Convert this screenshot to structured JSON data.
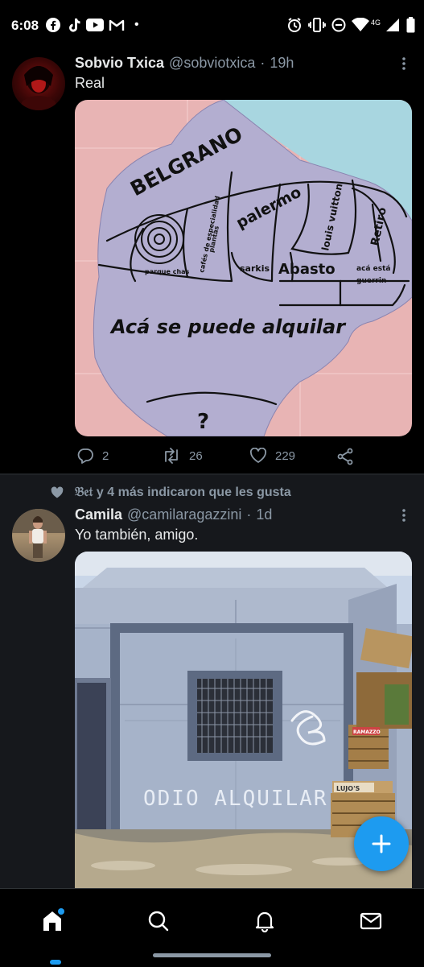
{
  "status_bar": {
    "time": "6:08",
    "network_label": "4G",
    "dot": "•"
  },
  "tweet1": {
    "display_name": "Sobvio Txica",
    "handle": "@sobviotxica",
    "separator": "·",
    "time": "19h",
    "text": "Real",
    "map": {
      "labels": {
        "belgrano": "BELGRANO",
        "palermo": "palermo",
        "louis_vuitton": "louis vuitton",
        "retiro": "Retiro",
        "cafes_line1": "cafés de especialidad",
        "cafes_line2": "plantas",
        "parque_chas": "parque chas",
        "sarkis": "sarkis",
        "abasto": "Abasto",
        "aca_esta_line1": "acá está",
        "aca_esta_line2": "guerrin",
        "main": "Acá se puede alquilar",
        "question": "?"
      }
    },
    "actions": {
      "replies": "2",
      "retweets": "26",
      "likes": "229"
    }
  },
  "tweet2": {
    "social_context": "𝔅𝔢𝔱 y 4 más indicaron que les gusta",
    "display_name": "Camila",
    "handle": "@camilaragazzini",
    "separator": "·",
    "time": "1d",
    "text": "Yo también, amigo.",
    "photo": {
      "graffiti_text": "ODIO ALQUILAR",
      "crate_labels": [
        "LUJO'S",
        "RAMAZZO"
      ]
    }
  },
  "colors": {
    "accent": "#1d9bf0",
    "background": "#000000",
    "secondary_text": "#8b98a5",
    "map_purple": "#b3aed0",
    "map_pink": "#e8b4b4",
    "map_sky": "#a8d6e0"
  }
}
